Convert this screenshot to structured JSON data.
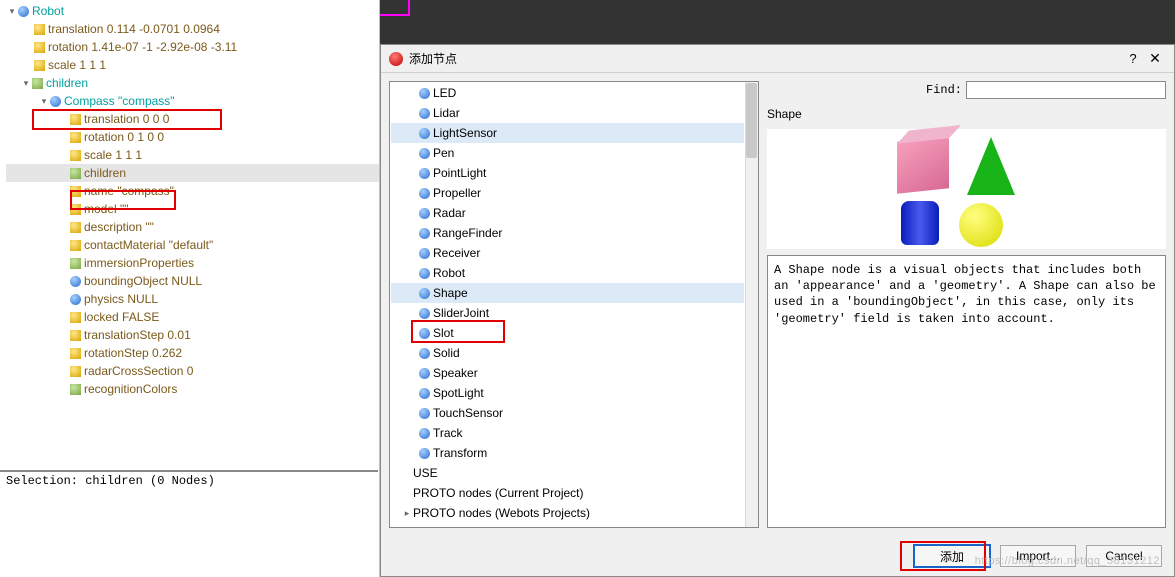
{
  "tree": {
    "robot": "Robot",
    "translation": "translation 0.114 -0.0701 0.0964",
    "rotation": "rotation 1.41e-07 -1 -2.92e-08 -3.11",
    "scale": "scale 1 1 1",
    "children": "children",
    "compass": "Compass \"compass\"",
    "c_translation": "translation 0 0 0",
    "c_rotation": "rotation 0 1 0 0",
    "c_scale": "scale 1 1 1",
    "c_children": "children",
    "c_name": "name \"compass\"",
    "c_model": "model \"\"",
    "c_description": "description \"\"",
    "c_contactMaterial": "contactMaterial \"default\"",
    "c_immersion": "immersionProperties",
    "c_bounding": "boundingObject NULL",
    "c_physics": "physics NULL",
    "c_locked": "locked FALSE",
    "c_translationStep": "translationStep 0.01",
    "c_rotationStep": "rotationStep 0.262",
    "c_radar": "radarCrossSection 0",
    "c_recognition": "recognitionColors"
  },
  "statusbar": "Selection: children (0 Nodes)",
  "dialog": {
    "title": "添加节点",
    "find_label": "Find:",
    "find_value": "",
    "shape_header": "Shape",
    "description": "A Shape node is a visual objects that includes both an 'appearance' and a 'geometry'. A Shape can also be used in a 'boundingObject', in this case, only its 'geometry' field is taken into account.",
    "nodes": [
      "LED",
      "Lidar",
      "LightSensor",
      "Pen",
      "PointLight",
      "Propeller",
      "Radar",
      "RangeFinder",
      "Receiver",
      "Robot",
      "Shape",
      "SliderJoint",
      "Slot",
      "Solid",
      "Speaker",
      "SpotLight",
      "TouchSensor",
      "Track",
      "Transform"
    ],
    "use": "USE",
    "proto1": "PROTO nodes (Current Project)",
    "proto2": "PROTO nodes (Webots Projects)",
    "btn_add": "添加",
    "btn_import": "Import...",
    "btn_cancel": "Cancel"
  }
}
